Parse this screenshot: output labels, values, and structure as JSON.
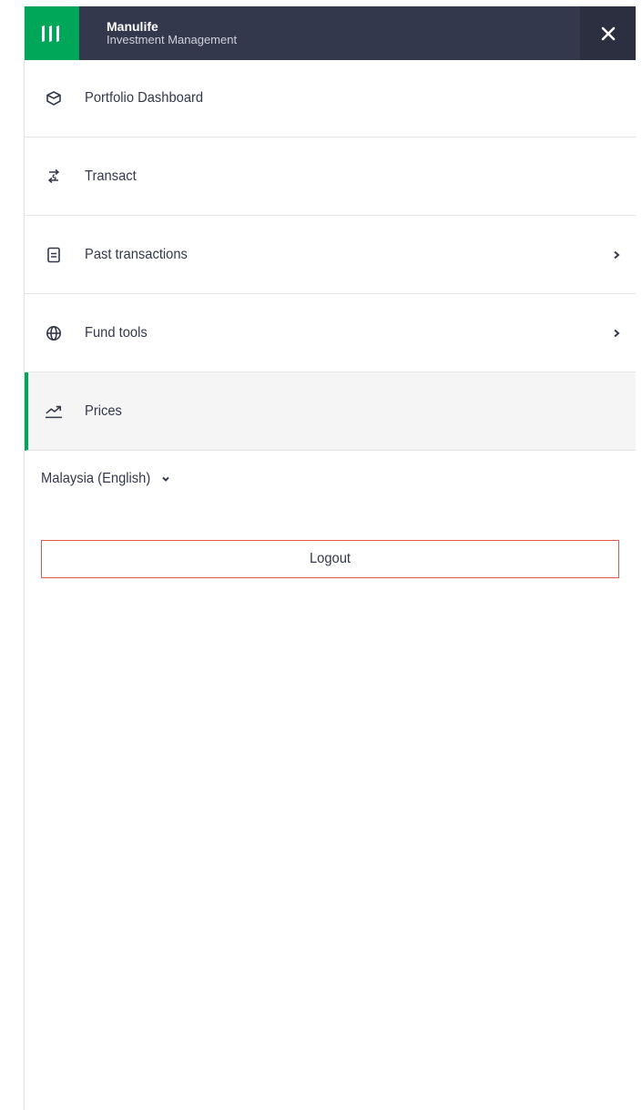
{
  "header": {
    "brand_name": "Manulife",
    "brand_sub": "Investment Management",
    "logo_icon": "manulife-logo-icon",
    "close_icon": "close-icon",
    "colors": {
      "bar": "#33384c",
      "logo_bg": "#00a758",
      "close_bg": "#2b2f40"
    }
  },
  "menu": {
    "items": [
      {
        "label": "Portfolio Dashboard",
        "icon": "cube-icon",
        "has_submenu": false,
        "active": false
      },
      {
        "label": "Transact",
        "icon": "exchange-icon",
        "has_submenu": false,
        "active": false
      },
      {
        "label": "Past transactions",
        "icon": "document-icon",
        "has_submenu": true,
        "active": false
      },
      {
        "label": "Fund tools",
        "icon": "globe-icon",
        "has_submenu": true,
        "active": false
      },
      {
        "label": "Prices",
        "icon": "trend-up-icon",
        "has_submenu": false,
        "active": true
      }
    ],
    "active_color": "#00a758"
  },
  "language": {
    "label": "Malaysia (English)",
    "icon": "chevron-down-icon"
  },
  "logout": {
    "label": "Logout",
    "border_color": "#e8564b"
  }
}
